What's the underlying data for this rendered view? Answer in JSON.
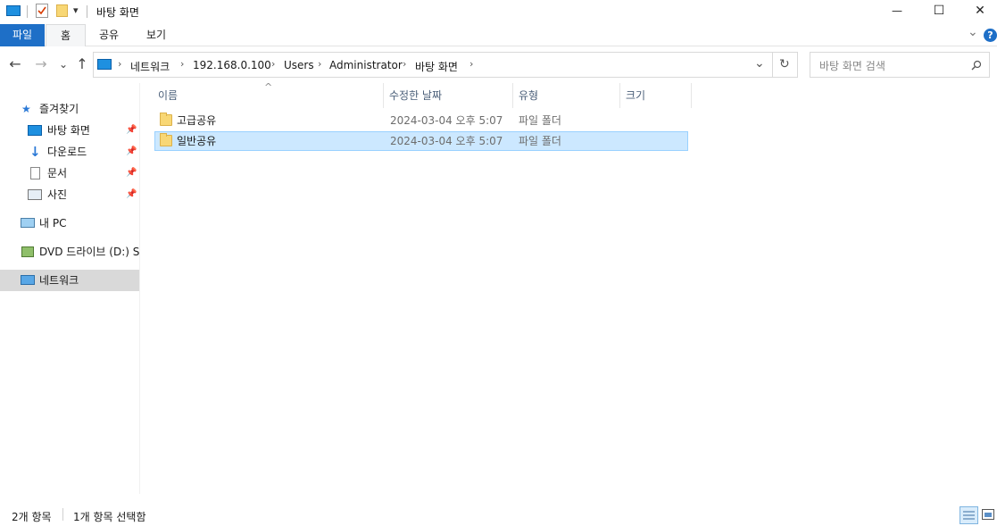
{
  "window": {
    "title": "바탕 화면",
    "controls": {
      "minimize": "—",
      "maximize": "☐",
      "close": "✕"
    }
  },
  "quick_access": {
    "icons": [
      "desktop-icon",
      "properties-icon",
      "new-folder-icon",
      "customize-dropdown-icon"
    ],
    "customize_glyph": "▾"
  },
  "ribbon": {
    "tabs": [
      {
        "label": "파일",
        "style": "file"
      },
      {
        "label": "홈",
        "style": "active"
      },
      {
        "label": "공유",
        "style": "normal"
      },
      {
        "label": "보기",
        "style": "normal"
      }
    ],
    "expand_glyph": "⌄",
    "help_glyph": "?"
  },
  "navigation": {
    "back": "←",
    "forward": "→",
    "recent": "⌄",
    "up": "↑"
  },
  "address": {
    "crumbs": [
      "네트워크",
      "192.168.0.100",
      "Users",
      "Administrator",
      "바탕 화면"
    ],
    "separator": "›",
    "dropdown_glyph": "⌄",
    "refresh_glyph": "↻"
  },
  "search": {
    "placeholder": "바탕 화면 검색",
    "icon": "search-icon"
  },
  "sidebar": {
    "quick_access_label": "즐겨찾기",
    "pinned": [
      {
        "label": "바탕 화면",
        "icon": "desktop-icon"
      },
      {
        "label": "다운로드",
        "icon": "download-icon"
      },
      {
        "label": "문서",
        "icon": "document-icon"
      },
      {
        "label": "사진",
        "icon": "pictures-icon"
      }
    ],
    "this_pc": "내 PC",
    "dvd": "DVD 드라이브 (D:) S",
    "network": "네트워크",
    "selected": "네트워크"
  },
  "columns": {
    "name": "이름",
    "modified": "수정한 날짜",
    "type": "유형",
    "size": "크기",
    "sort_glyph": "^"
  },
  "files": [
    {
      "name": "고급공유",
      "modified": "2024-03-04 오후 5:07",
      "type": "파일 폴더",
      "size": "",
      "selected": false
    },
    {
      "name": "일반공유",
      "modified": "2024-03-04 오후 5:07",
      "type": "파일 폴더",
      "size": "",
      "selected": true
    }
  ],
  "status": {
    "item_count": "2개 항목",
    "selection": "1개 항목 선택함",
    "view_icons": [
      "details-view-icon",
      "large-icons-view-icon"
    ]
  },
  "colors": {
    "accent": "#1e6fc7",
    "selection_bg": "#cce8ff",
    "selection_border": "#99d1ff",
    "folder": "#f8d775",
    "sidebar_selected": "#d9d9d9"
  }
}
